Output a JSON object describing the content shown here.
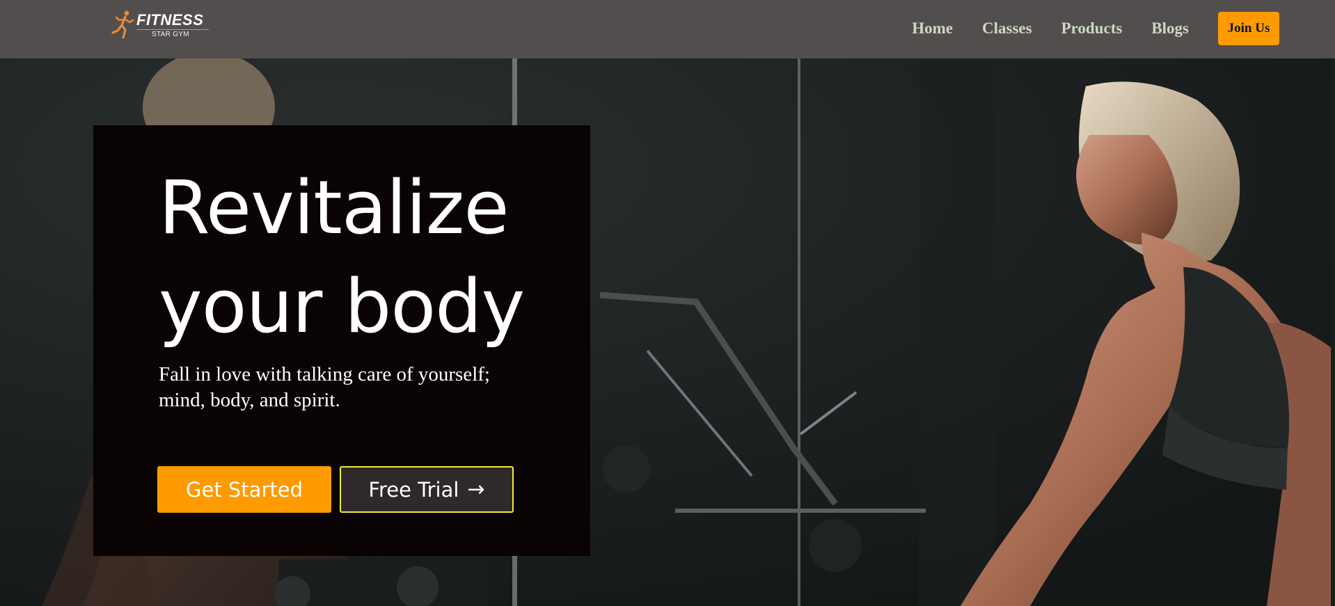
{
  "brand": {
    "title": "FITNESS",
    "subtitle": "STAR GYM",
    "accent_color": "#e8893b",
    "icon": "runner-icon"
  },
  "nav": {
    "links": [
      {
        "label": "Home"
      },
      {
        "label": "Classes"
      },
      {
        "label": "Products"
      },
      {
        "label": "Blogs"
      }
    ],
    "join_label": "Join Us",
    "link_color": "#cdd7c4",
    "join_color": "#ff9a00"
  },
  "hero": {
    "title_line1": "Revitalize",
    "title_line2": "your body",
    "subtitle": "Fall in love with talking care of yourself; mind, body, and spirit.",
    "primary_button": "Get Started",
    "secondary_button": "Free Trial",
    "secondary_icon": "arrow-right-icon",
    "primary_color": "#ff9a00",
    "secondary_border_color": "#f0ea3b",
    "background_image": "gym-woman-photo"
  }
}
